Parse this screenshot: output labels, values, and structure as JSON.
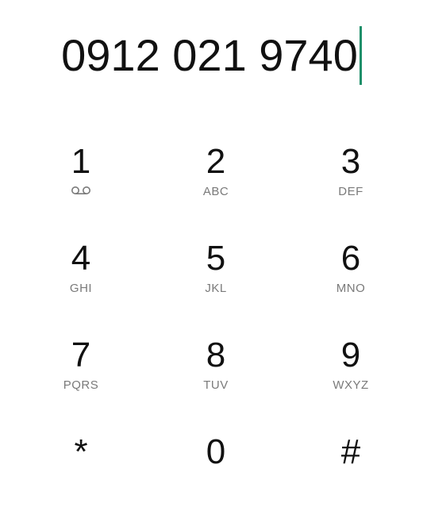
{
  "display": {
    "number": "0912 021 9740"
  },
  "keypad": {
    "keys": [
      {
        "digit": "1",
        "letters": "",
        "icon": "voicemail-icon"
      },
      {
        "digit": "2",
        "letters": "ABC"
      },
      {
        "digit": "3",
        "letters": "DEF"
      },
      {
        "digit": "4",
        "letters": "GHI"
      },
      {
        "digit": "5",
        "letters": "JKL"
      },
      {
        "digit": "6",
        "letters": "MNO"
      },
      {
        "digit": "7",
        "letters": "PQRS"
      },
      {
        "digit": "8",
        "letters": "TUV"
      },
      {
        "digit": "9",
        "letters": "WXYZ"
      },
      {
        "digit": "*",
        "letters": ""
      },
      {
        "digit": "0",
        "letters": ""
      },
      {
        "digit": "#",
        "letters": ""
      }
    ]
  },
  "colors": {
    "cursor": "#1f8f6a",
    "text": "#111111",
    "letters": "#7a7a7a"
  }
}
